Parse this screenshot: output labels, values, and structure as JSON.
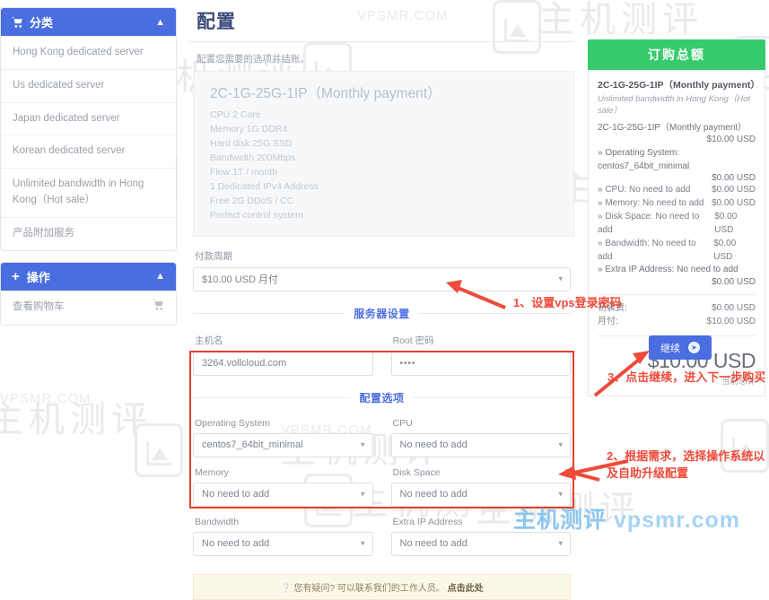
{
  "brand": {
    "accent_blue": "#4a6ee0",
    "accent_green": "#35cb6d",
    "annotation_red": "#ef4a3a"
  },
  "sidebar": {
    "categories": {
      "title": "分类",
      "icon": "cart-icon",
      "caret": "^",
      "items": [
        {
          "label": "Hong Kong dedicated server"
        },
        {
          "label": "Us dedicated server"
        },
        {
          "label": "Japan dedicated server"
        },
        {
          "label": "Korean dedicated server"
        },
        {
          "label": "Unlimited bandwidth in Hong Kong（Hot sale）"
        },
        {
          "label": "产品附加服务"
        }
      ]
    },
    "actions": {
      "title": "操作",
      "icon": "plus-icon",
      "caret": "^",
      "items": [
        {
          "label": "查看购物车",
          "icon": "cart-icon"
        }
      ]
    }
  },
  "main": {
    "page_title": "配置",
    "subtitle": "配置您需要的选项并结账。",
    "product": {
      "name": "2C-1G-25G-1IP（Monthly payment）",
      "specs": [
        "CPU 2 Core",
        "Memory 1G DDR4",
        "Hard disk 25G SSD",
        "Bandwidth 200Mbps",
        "Flow 1T / month",
        "1 Dedicated IPv4 Address",
        "Free 2G DDoS / CC",
        "Perfect control system"
      ]
    },
    "billing_cycle": {
      "label": "付款周期",
      "value": "$10.00 USD 月付"
    },
    "server_settings": {
      "section_title": "服务器设置",
      "hostname": {
        "label": "主机名",
        "value": "3264.vollcloud.com"
      },
      "root_password": {
        "label": "Root 密码",
        "value": "••••"
      }
    },
    "config_options": {
      "section_title": "配置选项",
      "fields": [
        {
          "label": "Operating System",
          "value": "centos7_64bit_minimal"
        },
        {
          "label": "CPU",
          "value": "No need to add"
        },
        {
          "label": "Memory",
          "value": "No need to add"
        },
        {
          "label": "Disk Space",
          "value": "No need to add"
        },
        {
          "label": "Bandwidth",
          "value": "No need to add"
        },
        {
          "label": "Extra IP Address",
          "value": "No need to add"
        }
      ]
    },
    "help_bar": {
      "text": "您有疑问? 可以联系我们的工作人员。",
      "link": "点击此处",
      "icon": "question-icon"
    }
  },
  "summary": {
    "header": "订购总额",
    "product_name": "2C-1G-25G-1IP（Monthly payment）",
    "product_group": "Unlimited bandwidth in Hong Kong（Hot sale）",
    "line_item": "2C-1G-25G-1IP（Monthly payment）",
    "line_item_price": "$10.00 USD",
    "options": [
      {
        "text": "» Operating System: centos7_64bit_minimal",
        "price": "$0.00 USD"
      },
      {
        "text": "» CPU: No need to add",
        "price": "$0.00 USD"
      },
      {
        "text": "» Memory: No need to add",
        "price": "$0.00 USD"
      },
      {
        "text": "» Disk Space: No need to add",
        "price": "$0.00 USD"
      },
      {
        "text": "» Bandwidth: No need to add",
        "price": "$0.00 USD"
      },
      {
        "text": "» Extra IP Address: No need to add",
        "price": "$0.00 USD"
      }
    ],
    "setup_fee_label": "初装费:",
    "setup_fee_value": "$0.00 USD",
    "monthly_label": "月付:",
    "monthly_value": "$10.00 USD",
    "grand_total": "$10.00 USD",
    "grand_total_caption": "当前总计"
  },
  "continue_button": {
    "label": "继续",
    "icon": "arrow-right-circle-icon"
  },
  "annotations": {
    "step1": "1、设置vps登录密码",
    "step3": "3、点击继续，进入下一步购买",
    "step2": "2、根据需求，选择操作系统以及自助升级配置"
  },
  "watermarks": {
    "cn": "主机测评",
    "domain": "VPSMR.COM",
    "footer_cn": "主机测评",
    "footer_domain": "vpsmr.com"
  }
}
